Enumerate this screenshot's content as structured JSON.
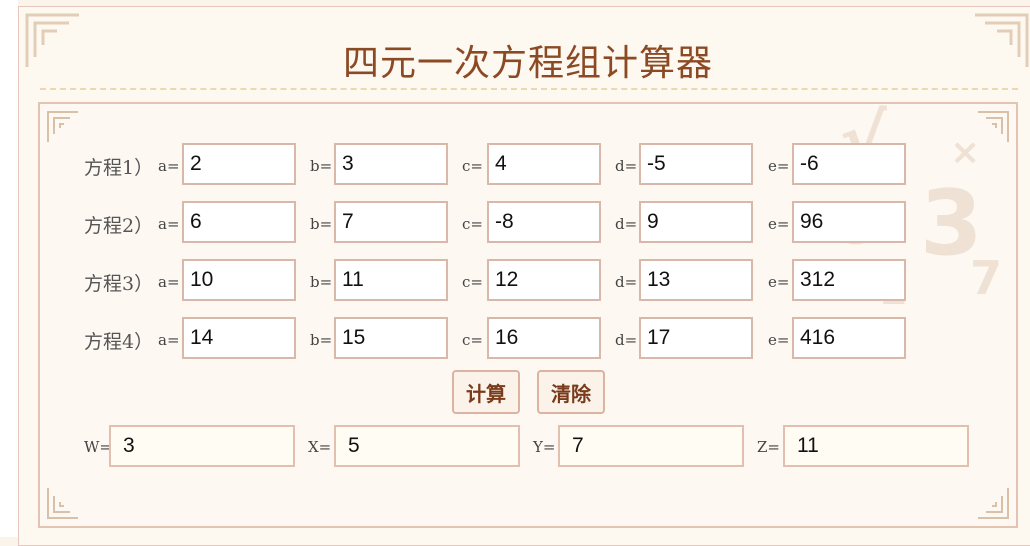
{
  "title": "四元一次方程组计算器",
  "equations": [
    {
      "label": "方程1）",
      "a": "2",
      "b": "3",
      "c": "4",
      "d": "-5",
      "e": "-6"
    },
    {
      "label": "方程2）",
      "a": "6",
      "b": "7",
      "c": "-8",
      "d": "9",
      "e": "96"
    },
    {
      "label": "方程3）",
      "a": "10",
      "b": "11",
      "c": "12",
      "d": "13",
      "e": "312"
    },
    {
      "label": "方程4）",
      "a": "14",
      "b": "15",
      "c": "16",
      "d": "17",
      "e": "416"
    }
  ],
  "var_labels": {
    "a": "a=",
    "b": "b=",
    "c": "c=",
    "d": "d=",
    "e": "e="
  },
  "buttons": {
    "calculate": "计算",
    "clear": "清除"
  },
  "results": [
    {
      "label": "W=",
      "value": "3"
    },
    {
      "label": "X=",
      "value": "5"
    },
    {
      "label": "Y=",
      "value": "7"
    },
    {
      "label": "Z=",
      "value": "11"
    }
  ],
  "colors": {
    "accent": "#8c4a24",
    "border": "#d9b8a9",
    "background": "#fdf8f0"
  }
}
